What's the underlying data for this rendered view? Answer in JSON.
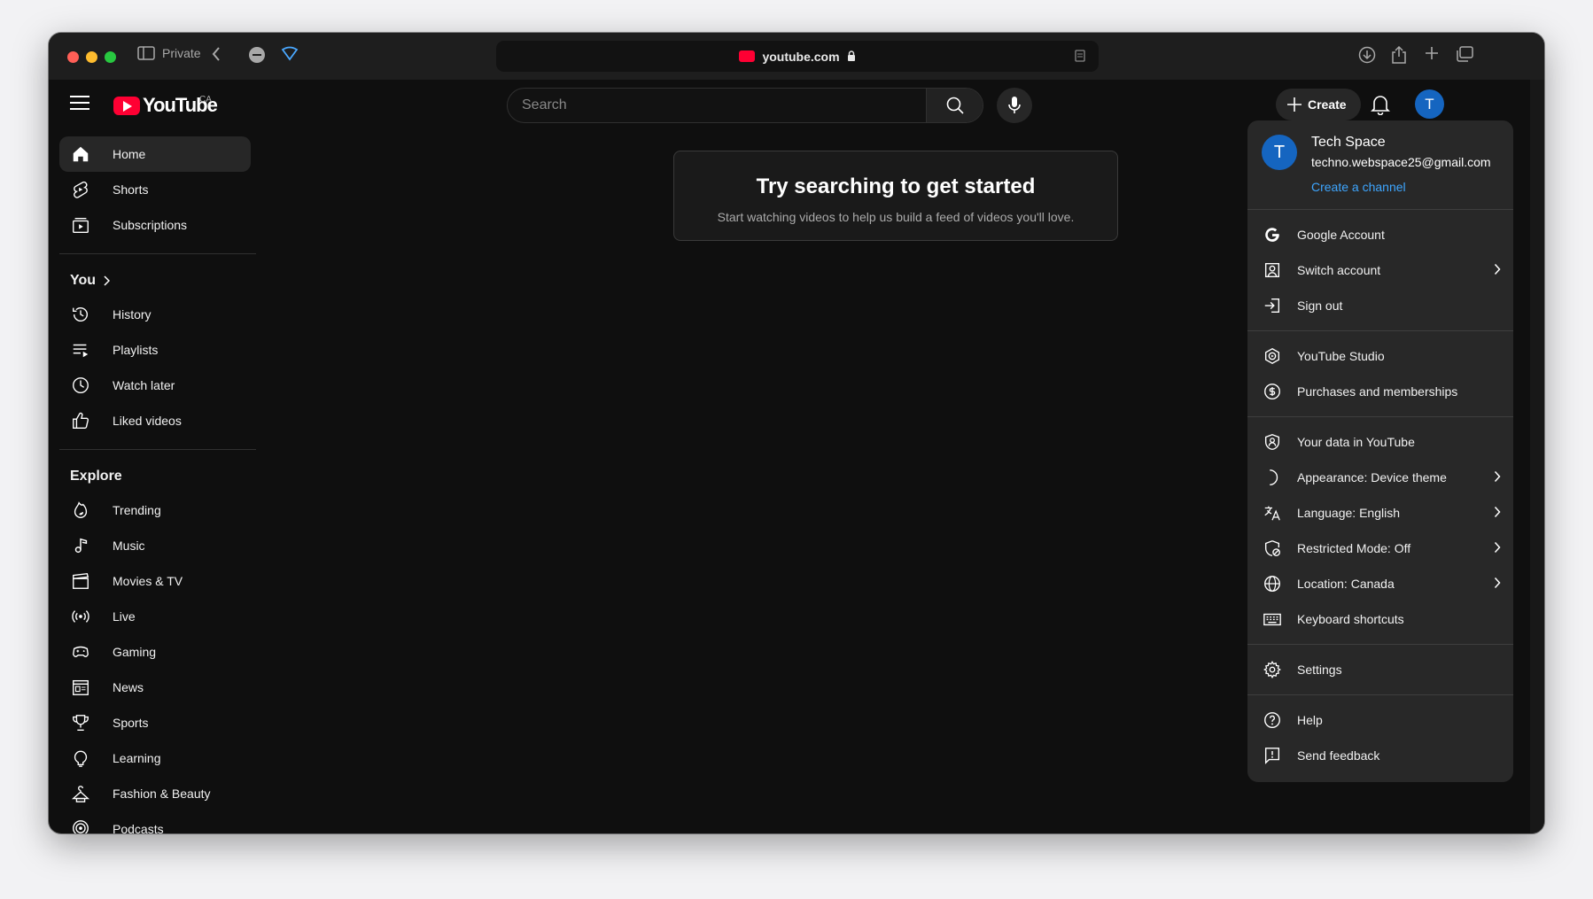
{
  "browser": {
    "private_label": "Private",
    "url": "youtube.com"
  },
  "header": {
    "logo_text": "YouTube",
    "country_code": "CA",
    "search_placeholder": "Search",
    "create_label": "Create",
    "avatar_letter": "T"
  },
  "sidebar": {
    "top": [
      {
        "label": "Home",
        "icon": "home-icon",
        "active": true
      },
      {
        "label": "Shorts",
        "icon": "shorts-icon"
      },
      {
        "label": "Subscriptions",
        "icon": "subscriptions-icon"
      }
    ],
    "you_title": "You",
    "you": [
      {
        "label": "History",
        "icon": "history-icon"
      },
      {
        "label": "Playlists",
        "icon": "playlists-icon"
      },
      {
        "label": "Watch later",
        "icon": "clock-icon"
      },
      {
        "label": "Liked videos",
        "icon": "thumbs-up-icon"
      }
    ],
    "explore_title": "Explore",
    "explore": [
      {
        "label": "Trending",
        "icon": "trending-icon"
      },
      {
        "label": "Music",
        "icon": "music-icon"
      },
      {
        "label": "Movies & TV",
        "icon": "clapperboard-icon"
      },
      {
        "label": "Live",
        "icon": "live-icon"
      },
      {
        "label": "Gaming",
        "icon": "gamepad-icon"
      },
      {
        "label": "News",
        "icon": "news-icon"
      },
      {
        "label": "Sports",
        "icon": "trophy-icon"
      },
      {
        "label": "Learning",
        "icon": "lightbulb-icon"
      },
      {
        "label": "Fashion & Beauty",
        "icon": "hanger-icon"
      },
      {
        "label": "Podcasts",
        "icon": "podcast-icon"
      }
    ]
  },
  "main": {
    "card_title": "Try searching to get started",
    "card_subtitle": "Start watching videos to help us build a feed of videos you'll love."
  },
  "account_menu": {
    "avatar_letter": "T",
    "name": "Tech Space",
    "email": "techno.webspace25@gmail.com",
    "create_channel": "Create a channel",
    "groups": [
      [
        {
          "label": "Google Account",
          "icon": "google-icon",
          "chevron": false
        },
        {
          "label": "Switch account",
          "icon": "switch-account-icon",
          "chevron": true
        },
        {
          "label": "Sign out",
          "icon": "sign-out-icon",
          "chevron": false
        }
      ],
      [
        {
          "label": "YouTube Studio",
          "icon": "studio-icon",
          "chevron": false
        },
        {
          "label": "Purchases and memberships",
          "icon": "dollar-icon",
          "chevron": false
        }
      ],
      [
        {
          "label": "Your data in YouTube",
          "icon": "shield-user-icon",
          "chevron": false
        },
        {
          "label": "Appearance: Device theme",
          "icon": "moon-icon",
          "chevron": true
        },
        {
          "label": "Language: English",
          "icon": "translate-icon",
          "chevron": true
        },
        {
          "label": "Restricted Mode: Off",
          "icon": "restricted-icon",
          "chevron": true
        },
        {
          "label": "Location: Canada",
          "icon": "globe-icon",
          "chevron": true
        },
        {
          "label": "Keyboard shortcuts",
          "icon": "keyboard-icon",
          "chevron": false
        }
      ],
      [
        {
          "label": "Settings",
          "icon": "gear-icon",
          "chevron": false
        }
      ],
      [
        {
          "label": "Help",
          "icon": "help-icon",
          "chevron": false
        },
        {
          "label": "Send feedback",
          "icon": "feedback-icon",
          "chevron": false
        }
      ]
    ]
  },
  "colors": {
    "background": "#0f0f0f",
    "menu_background": "#282828",
    "brand_red": "#ff0033",
    "link_blue": "#3ea6ff",
    "avatar_blue": "#1565c0"
  }
}
